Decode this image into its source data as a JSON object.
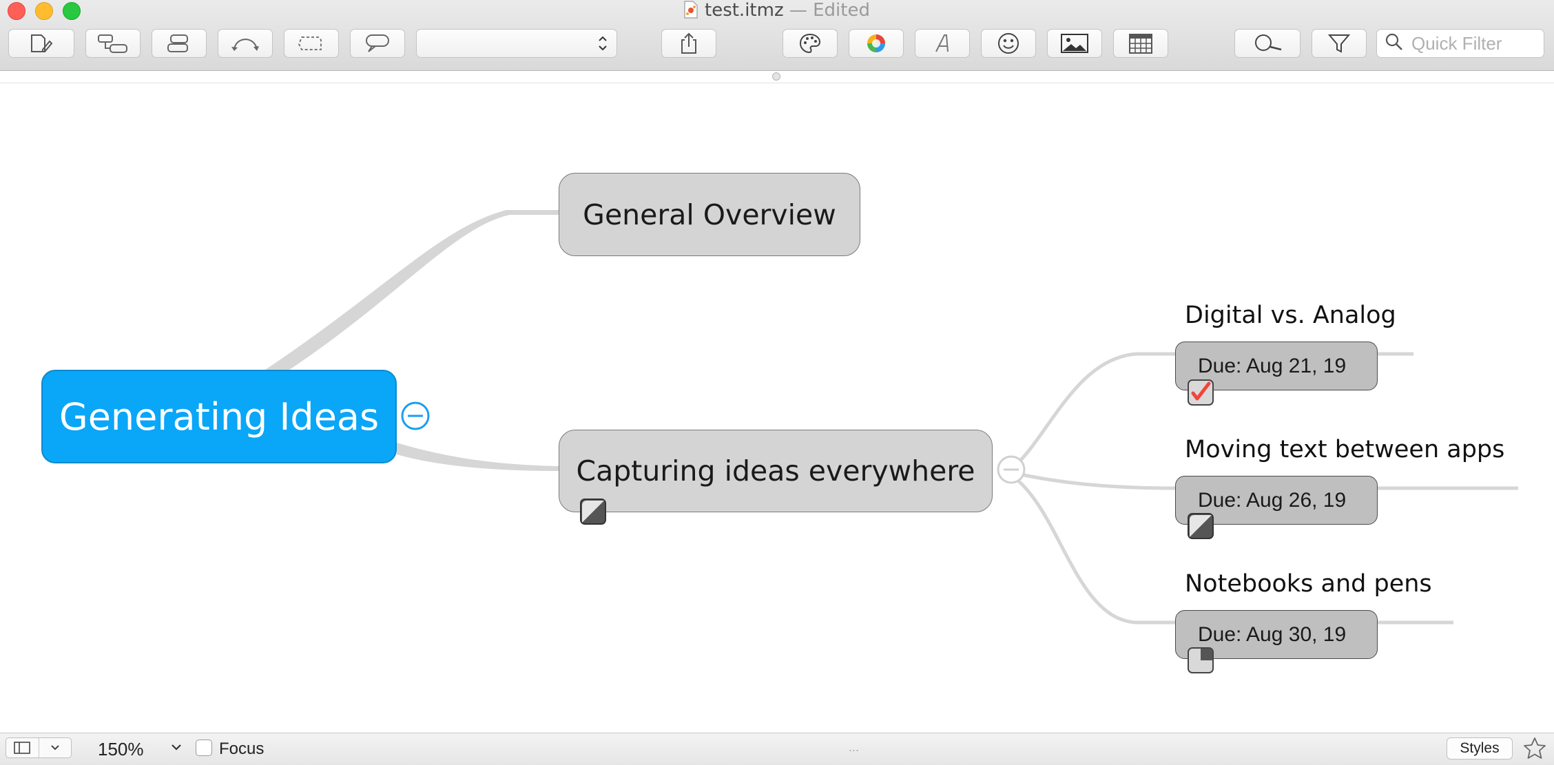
{
  "window": {
    "filename": "test.itmz",
    "status": " — Edited"
  },
  "toolbar": {
    "style_popup_value": "",
    "quick_filter_placeholder": "Quick Filter",
    "icons": [
      "new-topic-icon",
      "new-subtopic-icon",
      "new-parent-topic-icon",
      "relationship-icon",
      "boundary-icon",
      "callout-icon",
      "share-icon",
      "style-palette-icon",
      "color-wheel-icon",
      "font-icon",
      "emoji-icon",
      "image-icon",
      "calendar-icon",
      "zoom-to-fit-icon",
      "filter-icon",
      "search-icon"
    ]
  },
  "map": {
    "root": {
      "label": "Generating Ideas",
      "color": "#0aa6f8"
    },
    "topics": [
      {
        "label": "General Overview"
      },
      {
        "label": "Capturing ideas everywhere",
        "progress": 0.5,
        "subtopics": [
          {
            "title": "Digital vs. Analog",
            "due": "Due: Aug 21, 19",
            "progress": 1.0
          },
          {
            "title": "Moving text between apps",
            "due": "Due: Aug 26, 19",
            "progress": 0.5
          },
          {
            "title": "Notebooks and pens",
            "due": "Due: Aug 30, 19",
            "progress": 0.25
          }
        ]
      }
    ]
  },
  "statusbar": {
    "zoom": "150%",
    "focus_label": "Focus",
    "focus_checked": false,
    "dots": "...",
    "styles_label": "Styles"
  },
  "colors": {
    "accent": "#0aa6f8",
    "topic_fill": "#d4d4d4",
    "due_fill": "#bfbfbf",
    "check": "#f44336",
    "connector": "#d6d6d6"
  }
}
